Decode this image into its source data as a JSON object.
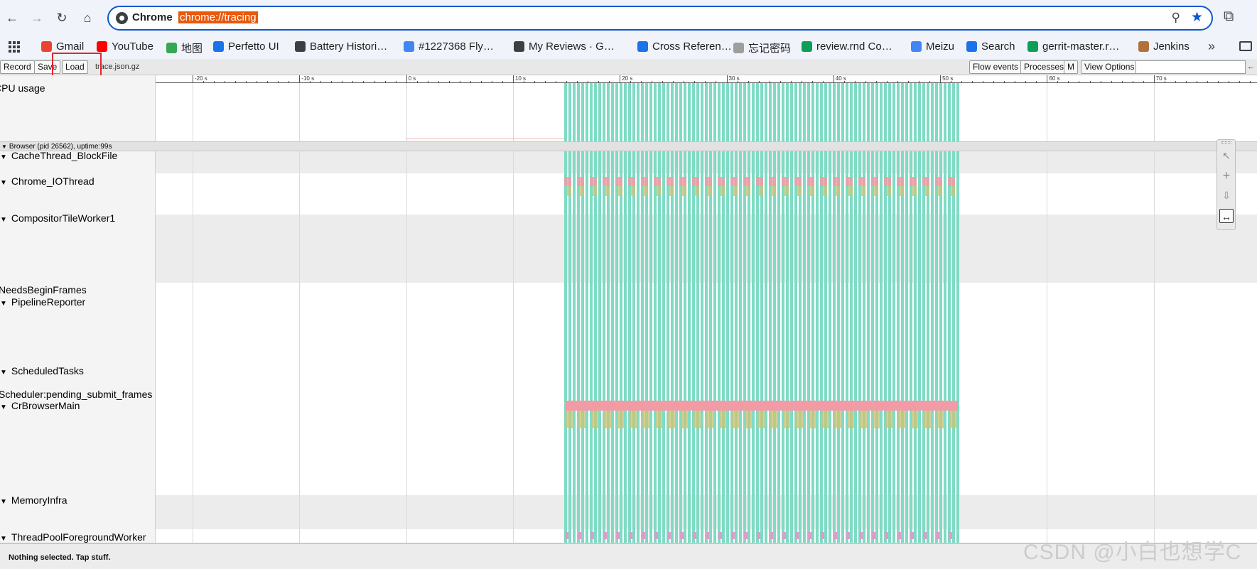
{
  "browser": {
    "site_name": "Chrome",
    "url": "chrome://tracing"
  },
  "bookmarks": [
    {
      "label": "Gmail",
      "color": "#ea4335"
    },
    {
      "label": "YouTube",
      "color": "#ff0000"
    },
    {
      "label": "地图",
      "color": "#34a853"
    },
    {
      "label": "Perfetto UI",
      "color": "#1a73e8"
    },
    {
      "label": "Battery Histori…",
      "color": "#3c4043"
    },
    {
      "label": "#1227368 Fly…",
      "color": "#4285f4"
    },
    {
      "label": "My Reviews · G…",
      "color": "#3c4043"
    },
    {
      "label": "Cross Referen…",
      "color": "#1a73e8"
    },
    {
      "label": "忘记密码",
      "color": "#9e9e9e"
    },
    {
      "label": "review.rnd Co…",
      "color": "#0f9d58"
    },
    {
      "label": "Meizu",
      "color": "#4285f4"
    },
    {
      "label": "Search",
      "color": "#1a73e8"
    },
    {
      "label": "gerrit-master.r…",
      "color": "#0f9d58"
    },
    {
      "label": "Jenkins",
      "color": "#b0713a"
    }
  ],
  "toolbar": {
    "record_label": "Record",
    "save_label": "Save",
    "load_label": "Load",
    "filename": "trace.json.gz",
    "flow_events_label": "Flow events",
    "processes_label": "Processes",
    "m_label": "M",
    "view_options_label": "View Options",
    "nav_arrow": "←"
  },
  "timeline": {
    "ticks": [
      "-20 s",
      "-10 s",
      "0 s",
      "10 s",
      "20 s",
      "30 s",
      "40 s",
      "50 s",
      "60 s",
      "70 s"
    ],
    "process_header": "Browser (pid 26562), uptime:99s",
    "tracks": [
      {
        "label": "CPU usage",
        "expandable": false
      },
      {
        "label": "CacheThread_BlockFile",
        "expandable": true
      },
      {
        "label": "Chrome_IOThread",
        "expandable": true
      },
      {
        "label": "CompositorTileWorker1",
        "expandable": true
      },
      {
        "label": "NeedsBeginFrames",
        "expandable": false
      },
      {
        "label": "PipelineReporter",
        "expandable": true
      },
      {
        "label": "ScheduledTasks",
        "expandable": true
      },
      {
        "label": "Scheduler:pending_submit_frames",
        "expandable": false
      },
      {
        "label": "CrBrowserMain",
        "expandable": true
      },
      {
        "label": "MemoryInfra",
        "expandable": true
      },
      {
        "label": "ThreadPoolForegroundWorker",
        "expandable": true
      }
    ],
    "slice_colors": [
      "#7fdbc4",
      "#f29aa6",
      "#c9c47a",
      "#d8a0c8"
    ]
  },
  "status": {
    "text": "Nothing selected. Tap stuff."
  },
  "watermark": "CSDN @小白也想学C"
}
